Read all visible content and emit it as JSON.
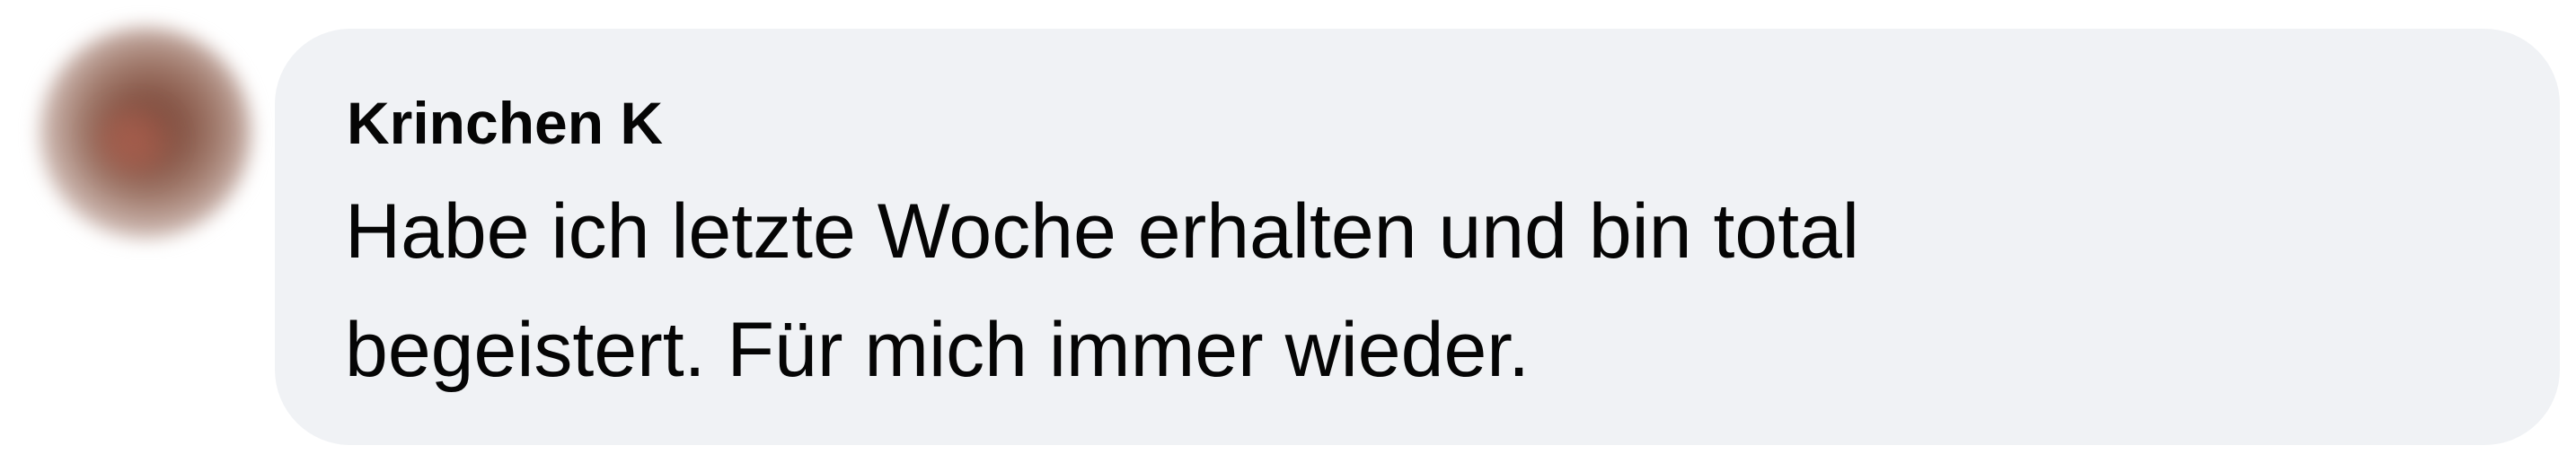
{
  "comment": {
    "author": "Krinchen K",
    "lines": [
      "Habe ich letzte Woche erhalten und bin total",
      "begeistert. Für mich immer wieder."
    ]
  },
  "colors": {
    "bubble_background": "#f0f2f5",
    "text": "#050505",
    "page_background": "#ffffff"
  }
}
